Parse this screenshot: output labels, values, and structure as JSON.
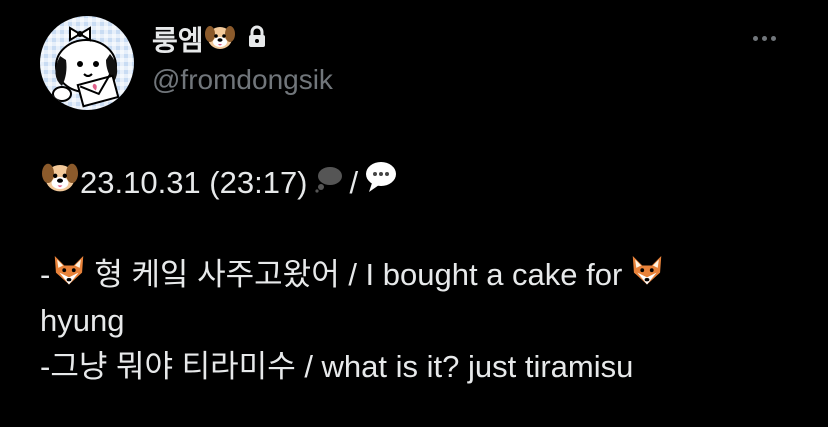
{
  "profile": {
    "display_name": "룽엠",
    "handle": "@fromdongsik",
    "name_emoji": "dog-face-icon",
    "protected_icon": "lock-icon"
  },
  "menu": {
    "icon": "more-options-icon"
  },
  "tweet": {
    "line1_text": "23.10.31 (23:17)",
    "line1_separator": "/",
    "line2_prefix": "-",
    "line2_text": "형 케잌 사주고왔어 / I bought a cake for",
    "line3_text": "hyung",
    "line4_text": "-그냥 뭐야 티라미수 / what is it? just tiramisu"
  },
  "colors": {
    "background": "#000000",
    "primary_text": "#e7e9ea",
    "secondary_text": "#71767b"
  }
}
